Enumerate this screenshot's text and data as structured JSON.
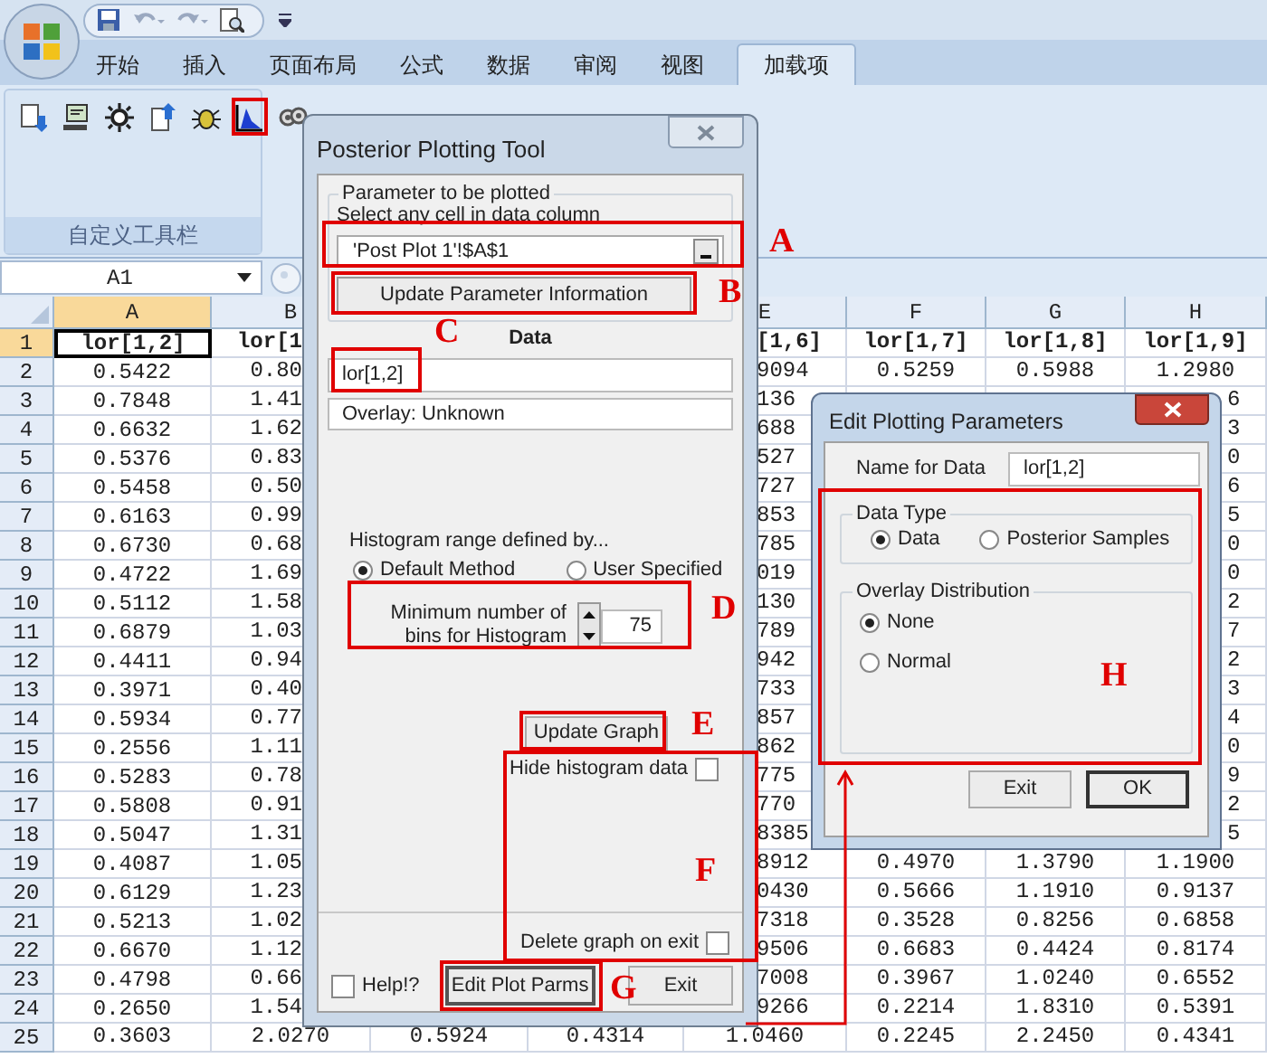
{
  "ribbon": {
    "tabs": [
      {
        "label": "开始",
        "selected": false
      },
      {
        "label": "插入",
        "selected": false
      },
      {
        "label": "页面布局",
        "selected": false
      },
      {
        "label": "公式",
        "selected": false
      },
      {
        "label": "数据",
        "selected": false
      },
      {
        "label": "审阅",
        "selected": false
      },
      {
        "label": "视图",
        "selected": false
      },
      {
        "label": "加载项",
        "selected": true
      }
    ],
    "tools": [
      {
        "highlighted": false
      },
      {
        "highlighted": false
      },
      {
        "highlighted": false
      },
      {
        "highlighted": false
      },
      {
        "highlighted": false
      },
      {
        "highlighted": true
      },
      {
        "highlighted": false
      }
    ],
    "group_label": "自定义工具栏"
  },
  "formula_bar": {
    "name_box": "A1"
  },
  "sheet": {
    "column_headers": [
      {
        "label": "A",
        "selected": true
      },
      {
        "label": "B",
        "selected": false
      },
      {
        "label": "E",
        "selected": false
      },
      {
        "label": "F",
        "selected": false
      },
      {
        "label": "G",
        "selected": false
      },
      {
        "label": "H",
        "selected": false
      }
    ],
    "rows": [
      {
        "kind": "partly_hidden",
        "number": "1",
        "selected": true,
        "a": "lor[1,2]",
        "b": "lor[1",
        "e": "[1,6]",
        "f": "lor[1,7]",
        "g": "lor[1,8]",
        "h": "lor[1,9]"
      },
      {
        "kind": "partly_hidden",
        "number": "2",
        "selected": false,
        "a": "0.5422",
        "b": "0.80",
        "e": "9094",
        "f": "0.5259",
        "g": "0.5988",
        "h": "1.2980"
      },
      {
        "kind": "partly_hidden",
        "number": "3",
        "selected": false,
        "a": "0.7848",
        "b": "1.41",
        "e": "136",
        "h_edge": "6"
      },
      {
        "kind": "partly_hidden",
        "number": "4",
        "selected": false,
        "a": "0.6632",
        "b": "1.62",
        "e": "688",
        "h_edge": "3"
      },
      {
        "kind": "partly_hidden",
        "number": "5",
        "selected": false,
        "a": "0.5376",
        "b": "0.83",
        "e": "527",
        "h_edge": "0"
      },
      {
        "kind": "partly_hidden",
        "number": "6",
        "selected": false,
        "a": "0.5458",
        "b": "0.50",
        "e": "727",
        "h_edge": "6"
      },
      {
        "kind": "partly_hidden",
        "number": "7",
        "selected": false,
        "a": "0.6163",
        "b": "0.99",
        "e": "853",
        "h_edge": "5"
      },
      {
        "kind": "partly_hidden",
        "number": "8",
        "selected": false,
        "a": "0.6730",
        "b": "0.68",
        "e": "785",
        "h_edge": "0"
      },
      {
        "kind": "partly_hidden",
        "number": "9",
        "selected": false,
        "a": "0.4722",
        "b": "1.69",
        "e": "019",
        "h_edge": "0"
      },
      {
        "kind": "partly_hidden",
        "number": "10",
        "selected": false,
        "a": "0.5112",
        "b": "1.58",
        "e": "130",
        "h_edge": "2"
      },
      {
        "kind": "partly_hidden",
        "number": "11",
        "selected": false,
        "a": "0.6879",
        "b": "1.03",
        "e": "789",
        "h_edge": "7"
      },
      {
        "kind": "partly_hidden",
        "number": "12",
        "selected": false,
        "a": "0.4411",
        "b": "0.94",
        "e": "942",
        "h_edge": "2"
      },
      {
        "kind": "partly_hidden",
        "number": "13",
        "selected": false,
        "a": "0.3971",
        "b": "0.40",
        "e": "733",
        "h_edge": "3"
      },
      {
        "kind": "partly_hidden",
        "number": "14",
        "selected": false,
        "a": "0.5934",
        "b": "0.77",
        "e": "857",
        "h_edge": "4"
      },
      {
        "kind": "partly_hidden",
        "number": "15",
        "selected": false,
        "a": "0.2556",
        "b": "1.11",
        "e": "862",
        "h_edge": "0"
      },
      {
        "kind": "partly_hidden",
        "number": "16",
        "selected": false,
        "a": "0.5283",
        "b": "0.78",
        "e": "775",
        "h_edge": "9"
      },
      {
        "kind": "partly_hidden",
        "number": "17",
        "selected": false,
        "a": "0.5808",
        "b": "0.91",
        "e": "770",
        "h_edge": "2"
      },
      {
        "kind": "partly_hidden",
        "number": "18",
        "selected": false,
        "a": "0.5047",
        "b": "1.31",
        "e": "8385",
        "h_edge": "5"
      },
      {
        "kind": "partly_hidden",
        "number": "19",
        "selected": false,
        "a": "0.4087",
        "b": "1.05",
        "e": "8912",
        "f": "0.4970",
        "g": "1.3790",
        "h": "1.1900"
      },
      {
        "kind": "partly_hidden",
        "number": "20",
        "selected": false,
        "a": "0.6129",
        "b": "1.23",
        "e": "0430",
        "f": "0.5666",
        "g": "1.1910",
        "h": "0.9137"
      },
      {
        "kind": "partly_hidden",
        "number": "21",
        "selected": false,
        "a": "0.5213",
        "b": "1.02",
        "e": "7318",
        "f": "0.3528",
        "g": "0.8256",
        "h": "0.6858"
      },
      {
        "kind": "partly_hidden",
        "number": "22",
        "selected": false,
        "a": "0.6670",
        "b": "1.12",
        "e": "9506",
        "f": "0.6683",
        "g": "0.4424",
        "h": "0.8174"
      },
      {
        "kind": "partly_hidden",
        "number": "23",
        "selected": false,
        "a": "0.4798",
        "b": "0.66",
        "e": "7008",
        "f": "0.3967",
        "g": "1.0240",
        "h": "0.6552"
      },
      {
        "kind": "partly_hidden",
        "number": "24",
        "selected": false,
        "a": "0.2650",
        "b": "1.54",
        "e": "9266",
        "f": "0.2214",
        "g": "1.8310",
        "h": "0.5391"
      },
      {
        "kind": "full",
        "number": "25",
        "selected": false,
        "a": "0.3603",
        "b": "2.0270",
        "c": "0.5924",
        "d": "0.4314",
        "e": "1.0460",
        "f": "0.2245",
        "g": "2.2450",
        "h": "0.4341"
      }
    ]
  },
  "plot_tool": {
    "title": "Posterior Plotting Tool",
    "group_label": "Parameter to be plotted",
    "select_label": "Select any cell in data column",
    "range_field": "'Post Plot 1'!$A$1",
    "update_button": "Update Parameter Information",
    "data_heading": "Data",
    "data_name": "lor[1,2]",
    "overlay": "Overlay: Unknown",
    "histogram_label": "Histogram range defined by...",
    "range_options": [
      {
        "label": "Default Method",
        "selected": true
      },
      {
        "label": "User Specified",
        "selected": false
      }
    ],
    "bins_label": "Minimum number of bins for Histogram",
    "bins_value": "75",
    "update_graph_button": "Update Graph",
    "hide_histogram": {
      "label": "Hide histogram data",
      "checked": false
    },
    "delete_graph": {
      "label": "Delete graph on exit",
      "checked": false
    },
    "help": {
      "label": "Help!?",
      "checked": false
    },
    "buttons": [
      "Edit Plot Parms",
      "Exit"
    ]
  },
  "edit_dialog": {
    "title": "Edit Plotting Parameters",
    "name_label": "Name for Data",
    "name_value": "lor[1,2]",
    "data_type": {
      "label": "Data Type",
      "options": [
        {
          "label": "Data",
          "selected": true
        },
        {
          "label": "Posterior Samples",
          "selected": false
        }
      ]
    },
    "overlay": {
      "label": "Overlay Distribution",
      "options": [
        {
          "label": "None",
          "selected": true
        },
        {
          "label": "Normal",
          "selected": false
        }
      ]
    },
    "buttons": [
      "Exit",
      "OK"
    ]
  },
  "annotations": [
    "A",
    "B",
    "C",
    "D",
    "E",
    "F",
    "G",
    "H"
  ]
}
